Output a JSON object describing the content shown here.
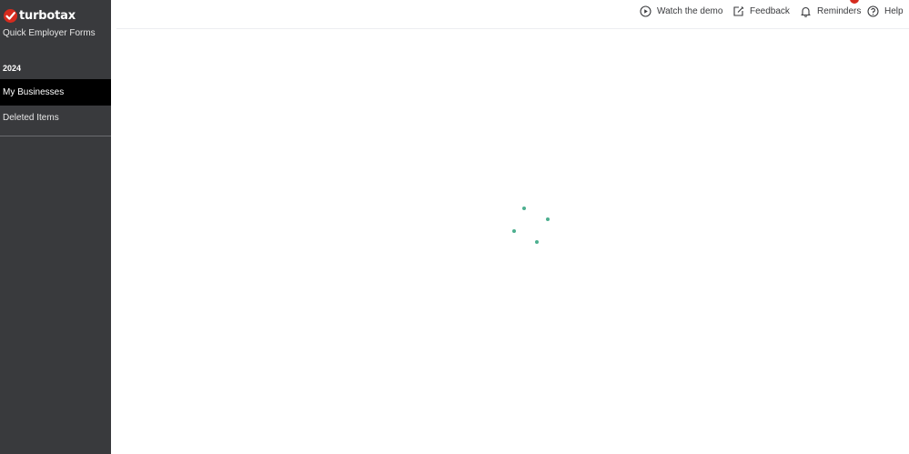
{
  "sidebar": {
    "logo_text": "turbotax",
    "subtitle": "Quick Employer Forms",
    "year": "2024",
    "items": [
      {
        "label": "My Businesses",
        "active": true
      },
      {
        "label": "Deleted Items",
        "active": false
      }
    ]
  },
  "topbar": {
    "watch_demo": "Watch the demo",
    "feedback": "Feedback",
    "reminders": "Reminders",
    "help": "Help"
  },
  "icons": {
    "logo": "turbotax-check-icon",
    "watch_demo": "play-circle-icon",
    "feedback": "edit-note-icon",
    "reminders": "bell-icon",
    "help": "question-circle-icon",
    "loading": "loading-spinner-icon"
  },
  "colors": {
    "sidebar_bg": "#393a3d",
    "active_item_bg": "#000000",
    "brand_red": "#d52b1e",
    "spinner": "#4caf8f"
  }
}
